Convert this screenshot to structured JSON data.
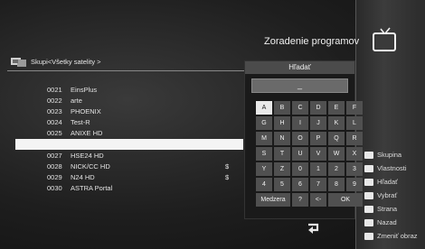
{
  "header": {
    "title": "Zoradenie programov"
  },
  "group": {
    "label": "Skupi<Všetky satelity >"
  },
  "channels": [
    {
      "num": "0021",
      "name": "EinsPlus",
      "sym": ""
    },
    {
      "num": "0022",
      "name": "arte",
      "sym": ""
    },
    {
      "num": "0023",
      "name": "PHOENIX",
      "sym": ""
    },
    {
      "num": "0024",
      "name": "Test-R",
      "sym": ""
    },
    {
      "num": "0025",
      "name": "ANIXE HD",
      "sym": ""
    },
    {
      "num": "",
      "name": "",
      "sym": ""
    },
    {
      "num": "0027",
      "name": "HSE24 HD",
      "sym": ""
    },
    {
      "num": "0028",
      "name": "NICK/CC HD",
      "sym": "$"
    },
    {
      "num": "0029",
      "name": "N24 HD",
      "sym": "$"
    },
    {
      "num": "0030",
      "name": "ASTRA Portal",
      "sym": ""
    }
  ],
  "search": {
    "title": "Hľadať",
    "input_value": "_",
    "keys": [
      "A",
      "B",
      "C",
      "D",
      "E",
      "F",
      "G",
      "H",
      "I",
      "J",
      "K",
      "L",
      "M",
      "N",
      "O",
      "P",
      "Q",
      "R",
      "S",
      "T",
      "U",
      "V",
      "W",
      "X",
      "Y",
      "Z",
      "0",
      "1",
      "2",
      "3",
      "4",
      "5",
      "6",
      "7",
      "8",
      "9"
    ],
    "bottom": {
      "space": "Medzera",
      "question": "?",
      "backspace": "<-",
      "ok": "OK"
    }
  },
  "legend": [
    {
      "key": "",
      "label": "Skupina"
    },
    {
      "key": "",
      "label": "Vlastnosti"
    },
    {
      "key": "",
      "label": "Hľadať"
    },
    {
      "key": "",
      "label": "Vybrať"
    },
    {
      "key": "",
      "label": "Strana"
    },
    {
      "key": "",
      "label": "Nazad"
    },
    {
      "key": "",
      "label": "Zmeniť obraz"
    }
  ],
  "icons": {
    "tv": "tv-icon",
    "group": "satellite-group-icon",
    "back": "back-arrow-icon"
  },
  "colors": {
    "selected_row": "#f4f4f4",
    "key_active": "#e9e9e9"
  }
}
